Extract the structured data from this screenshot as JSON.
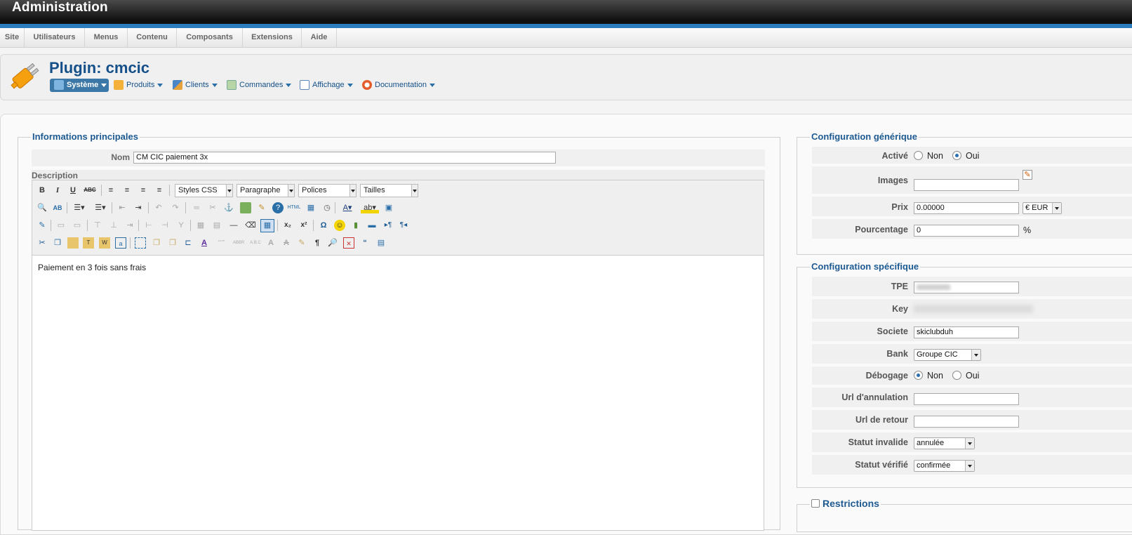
{
  "app": {
    "title": "Administration"
  },
  "menu": [
    {
      "label": "Site"
    },
    {
      "label": "Utilisateurs"
    },
    {
      "label": "Menus"
    },
    {
      "label": "Contenu"
    },
    {
      "label": "Composants"
    },
    {
      "label": "Extensions"
    },
    {
      "label": "Aide"
    }
  ],
  "page": {
    "title": "Plugin: cmcic"
  },
  "header_menu": [
    {
      "label": "Système",
      "icon": "wrench-icon"
    },
    {
      "label": "Produits",
      "icon": "box-icon"
    },
    {
      "label": "Clients",
      "icon": "users-icon"
    },
    {
      "label": "Commandes",
      "icon": "orders-icon"
    },
    {
      "label": "Affichage",
      "icon": "display-icon"
    },
    {
      "label": "Documentation",
      "icon": "lifebuoy-icon"
    }
  ],
  "main_info": {
    "legend": "Informations principales",
    "name_label": "Nom",
    "name_value": "CM CIC paiement 3x",
    "description_label": "Description",
    "editor": {
      "styles": "Styles CSS",
      "format": "Paragraphe",
      "fonts": "Polices",
      "sizes": "Tailles",
      "content": "Paiement en 3 fois sans frais"
    }
  },
  "generic": {
    "legend": "Configuration générique",
    "active_label": "Activé",
    "no_label": "Non",
    "yes_label": "Oui",
    "active_value": "Oui",
    "images_label": "Images",
    "price_label": "Prix",
    "price_value": "0.00000",
    "currency": "€ EUR",
    "percent_label": "Pourcentage",
    "percent_value": "0",
    "percent_unit": "%"
  },
  "specific": {
    "legend": "Configuration spécifique",
    "tpe_label": "TPE",
    "key_label": "Key",
    "company_label": "Societe",
    "company_value": "skiclubduh",
    "bank_label": "Bank",
    "bank_value": "Groupe CIC",
    "debug_label": "Débogage",
    "debug_no": "Non",
    "debug_yes": "Oui",
    "debug_value": "Non",
    "cancel_url_label": "Url d'annulation",
    "return_url_label": "Url de retour",
    "invalid_status_label": "Statut invalide",
    "invalid_status_value": "annulée",
    "verified_status_label": "Statut vérifié",
    "verified_status_value": "confirmée"
  },
  "restrictions": {
    "legend": "Restrictions"
  },
  "colors": {
    "accent": "#2a7dbf",
    "title": "#15508a"
  }
}
